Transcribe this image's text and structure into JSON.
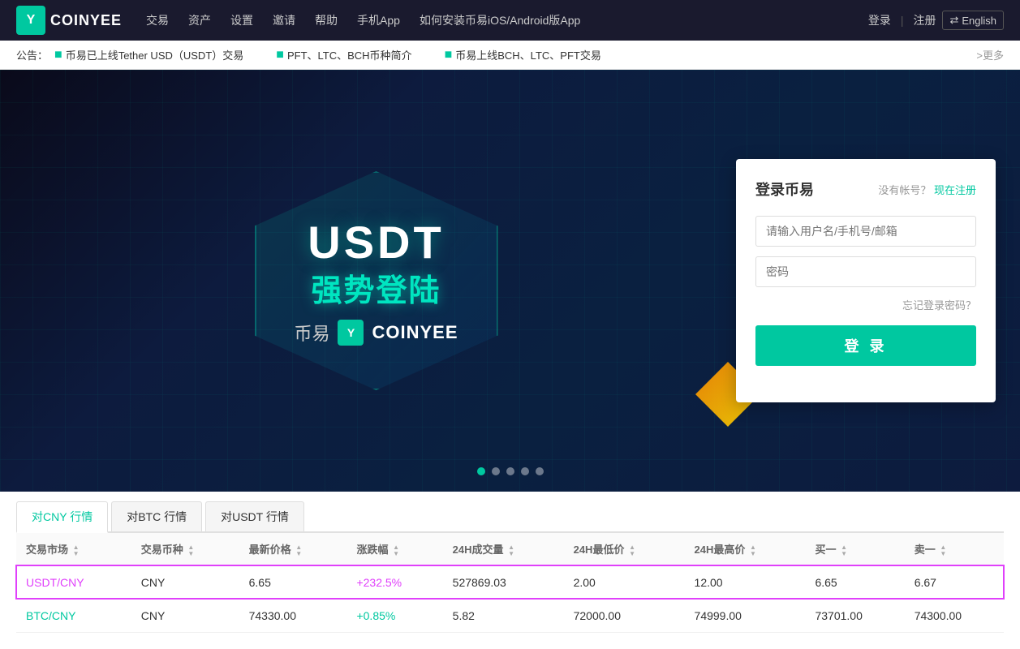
{
  "brand": {
    "logo_letter": "Y",
    "name": "COINYEE"
  },
  "navbar": {
    "links": [
      {
        "label": "交易",
        "id": "trade"
      },
      {
        "label": "资产",
        "id": "assets"
      },
      {
        "label": "设置",
        "id": "settings"
      },
      {
        "label": "邀请",
        "id": "invite"
      },
      {
        "label": "帮助",
        "id": "help"
      },
      {
        "label": "手机App",
        "id": "mobile"
      },
      {
        "label": "如何安装币易iOS/Android版App",
        "id": "install"
      }
    ],
    "login": "登录",
    "register": "注册",
    "lang_icon": "⇄",
    "lang": "English"
  },
  "announce": {
    "label": "公告：",
    "items": [
      "币易已上线Tether USD（USDT）交易",
      "PFT、LTC、BCH币种简介",
      "币易上线BCH、LTC、PFT交易"
    ],
    "more": ">更多"
  },
  "hero": {
    "title_main": "USDT",
    "title_sub": "强势登陆",
    "brand_label": "币易",
    "brand_name": "COINYEE"
  },
  "login_panel": {
    "title": "登录币易",
    "no_account": "没有帐号？",
    "register_now": "现在注册",
    "username_placeholder": "请输入用户名/手机号/邮箱",
    "password_placeholder": "密码",
    "forgot": "忘记登录密码？",
    "login_btn": "登 录"
  },
  "carousel": {
    "dots": [
      {
        "active": true
      },
      {
        "active": false
      },
      {
        "active": false
      },
      {
        "active": false
      },
      {
        "active": false
      }
    ]
  },
  "market": {
    "tabs": [
      {
        "label": "对CNY 行情",
        "active": true
      },
      {
        "label": "对BTC 行情",
        "active": false
      },
      {
        "label": "对USDT 行情",
        "active": false
      }
    ],
    "columns": [
      {
        "label": "交易市场"
      },
      {
        "label": "交易币种"
      },
      {
        "label": "最新价格"
      },
      {
        "label": "涨跌幅"
      },
      {
        "label": "24H成交量"
      },
      {
        "label": "24H最低价"
      },
      {
        "label": "24H最高价"
      },
      {
        "label": "买一"
      },
      {
        "label": "卖一"
      }
    ],
    "rows": [
      {
        "market": "USDT/CNY",
        "currency": "CNY",
        "price": "6.65",
        "change": "+232.5%",
        "volume": "527869.03",
        "low": "2.00",
        "high": "12.00",
        "buy": "6.65",
        "sell": "6.67",
        "change_class": "positive",
        "market_class": "purple",
        "highlighted": true
      },
      {
        "market": "BTC/CNY",
        "currency": "CNY",
        "price": "74330.00",
        "change": "+0.85%",
        "volume": "5.82",
        "low": "72000.00",
        "high": "74999.00",
        "buy": "73701.00",
        "sell": "74300.00",
        "change_class": "green",
        "market_class": "green",
        "highlighted": false
      }
    ]
  }
}
